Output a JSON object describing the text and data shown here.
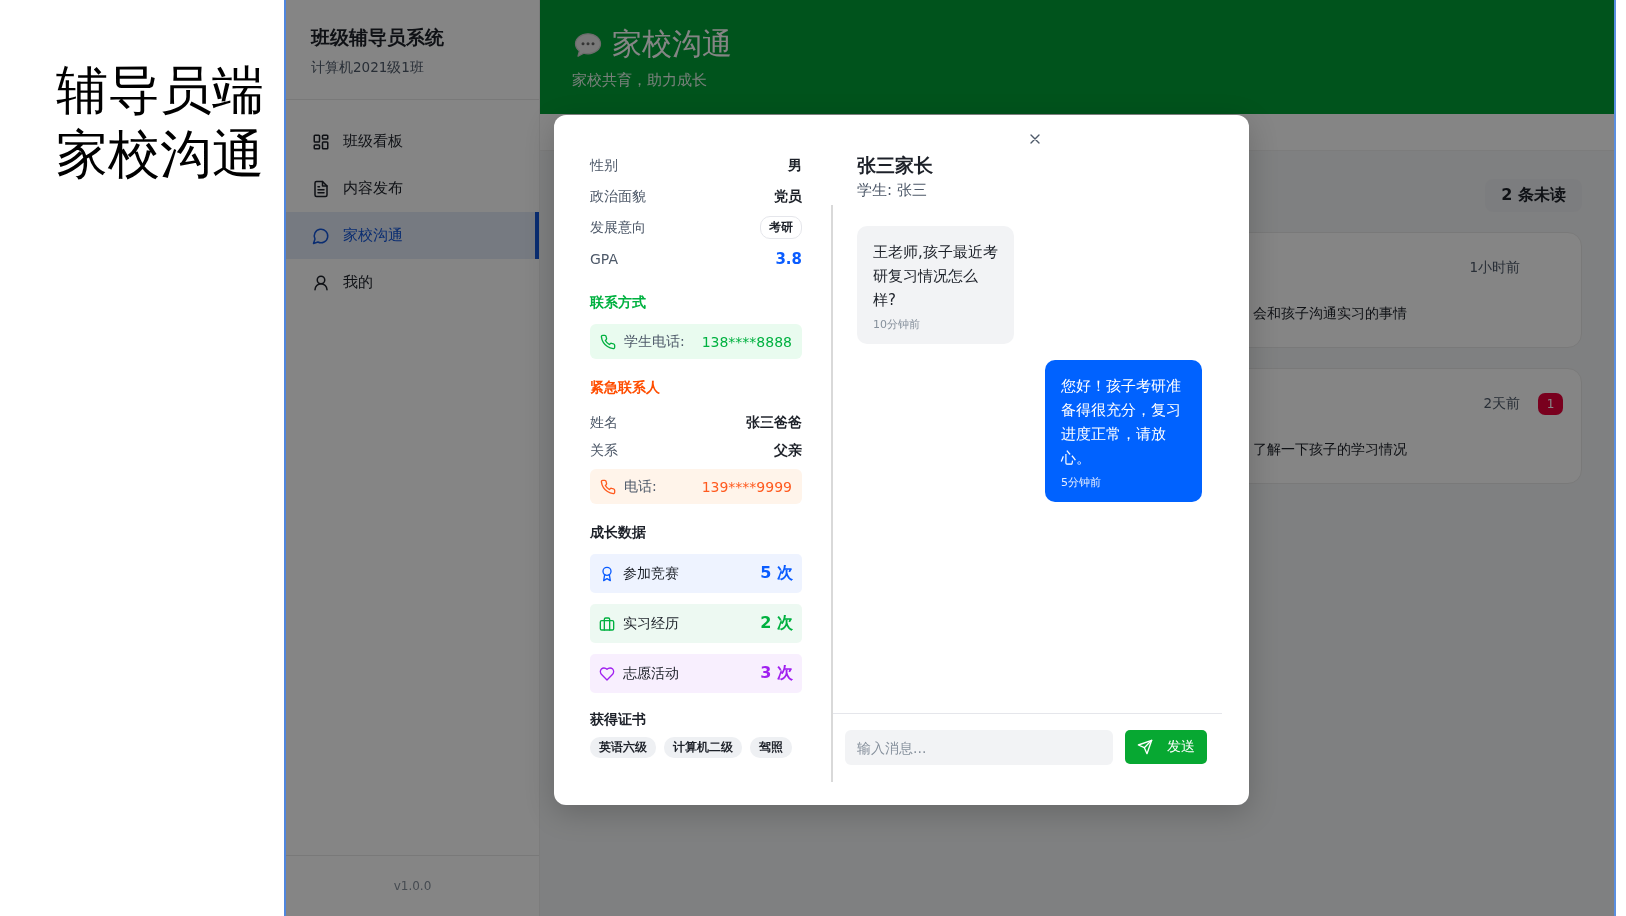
{
  "caption": {
    "lines": [
      "辅导员端",
      "家校沟通"
    ]
  },
  "sidebar": {
    "title": "班级辅导员系统",
    "subtitle": "计算机2021级1班",
    "items": [
      {
        "label": "班级看板",
        "selected": false
      },
      {
        "label": "内容发布",
        "selected": false
      },
      {
        "label": "家校沟通",
        "selected": true
      },
      {
        "label": "我的",
        "selected": false
      }
    ],
    "version": "v1.0.0"
  },
  "header": {
    "title": "家校沟通",
    "subtitle": "家校共育，助力成长"
  },
  "unread_summary": "2 条未读",
  "conversations": [
    {
      "time": "1小时前",
      "preview": "会和孩子沟通实习的事情"
    },
    {
      "time": "2天前",
      "unread": "1",
      "preview": "了解一下孩子的学习情况"
    }
  ],
  "modal": {
    "profile": [
      {
        "kind": "text",
        "label": "性别",
        "value": "男"
      },
      {
        "kind": "text",
        "label": "政治面貌",
        "value": "党员"
      },
      {
        "kind": "tag",
        "label": "发展意向",
        "value": "考研"
      },
      {
        "kind": "highlight",
        "label": "GPA",
        "value": "3.8"
      }
    ],
    "contact": {
      "heading": "联系方式",
      "phone_label": "学生电话:",
      "phone": "138****8888"
    },
    "emergency": {
      "heading": "紧急联系人",
      "rows": [
        {
          "label": "姓名",
          "value": "张三爸爸"
        },
        {
          "label": "关系",
          "value": "父亲"
        }
      ],
      "phone_label": "电话:",
      "phone": "139****9999"
    },
    "growth": {
      "heading": "成长数据",
      "stats": [
        {
          "label": "参加竞赛",
          "value": "5 次",
          "color": "#0a5cff"
        },
        {
          "label": "实习经历",
          "value": "2 次",
          "color": "#00b140"
        },
        {
          "label": "志愿活动",
          "value": "3 次",
          "color": "#a020f0"
        }
      ]
    },
    "certificates": {
      "heading": "获得证书",
      "items": [
        "英语六级",
        "计算机二级",
        "驾照"
      ]
    },
    "chat": {
      "title": "张三家长",
      "subtitle": "学生: 张三",
      "messages": [
        {
          "kind": "received",
          "text": "王老师,孩子最近考研复习情况怎么样?",
          "time": "10分钟前"
        },
        {
          "kind": "sent",
          "text": "您好！孩子考研准备得很充分，复习进度正常，请放心。",
          "time": "5分钟前"
        }
      ],
      "input_placeholder": "输入消息...",
      "send_label": "发送"
    }
  }
}
